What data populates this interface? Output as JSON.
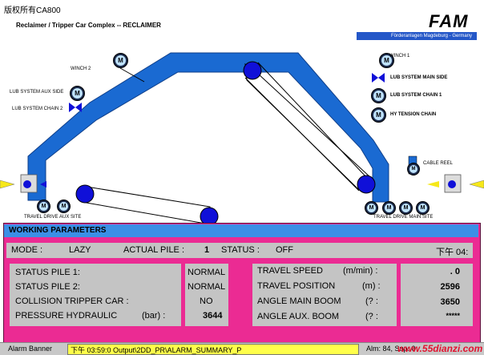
{
  "corner_watermark": "版权所有CA800",
  "header": {
    "title": "Reclaimer / Tripper Car Complex  --  RECLAIMER",
    "logo": "FAM",
    "company": "Förderanlagen Magdeburg - Germany"
  },
  "diagram": {
    "winch_left": "WINCH 2",
    "winch_right": "WINCH 1",
    "lub_aux_side": "LUB SYSTEM AUX SIDE",
    "lub_chain_2": "LUB SYSTEM CHAIN 2",
    "lub_main_side": "LUB SYSTEM MAIN SIDE",
    "lub_chain_1": "LUB SYSTEM CHAIN 1",
    "hy_tension_chain": "HY TENSION CHAIN",
    "cable_reel": "CABLE REEL",
    "travel_drive_aux": "TRAVEL DRIVE AUX SITE",
    "travel_drive_main": "TRAVEL DRIVE MAIN SITE",
    "motor_glyph": "M",
    "colors": {
      "boom": "#1a6ad2",
      "drum": "#1010d8",
      "motor_ring": "#1b2a4a",
      "panel_bg": "#eb2b93",
      "panel_header": "#3b8fe6"
    }
  },
  "working_parameters": {
    "title": "WORKING PARAMETERS",
    "mode_label": "MODE :",
    "mode_value": "LAZY",
    "actual_pile_label": "ACTUAL PILE :",
    "actual_pile_value": "1",
    "status_label": "STATUS :",
    "status_value": "OFF",
    "clock": "下午 04:",
    "left_labels": [
      "STATUS PILE  1:",
      "STATUS PILE  2:",
      "COLLISION TRIPPER CAR :",
      "PRESSURE HYDRAULIC"
    ],
    "pressure_unit": "(bar) :",
    "left_values": [
      "NORMAL",
      "NORMAL",
      "NO",
      "3644"
    ],
    "right_labels": [
      "TRAVEL SPEED",
      "TRAVEL POSITION",
      "ANGLE MAIN BOOM",
      "ANGLE AUX. BOOM"
    ],
    "right_units": [
      "(m/min) :",
      "(m)  :",
      "(?  :",
      "(?  :"
    ],
    "right_values": [
      ". 0",
      "2596",
      "3650",
      "*****"
    ]
  },
  "alarm_banner": {
    "label": "Alarm Banner",
    "message": "下午 03:59:0 Output\\2DD_PR\\ALARM_SUMMARY_P",
    "counts": "Alm:  84, Sup:   0",
    "site_watermark": "www.55dianzi.com"
  }
}
